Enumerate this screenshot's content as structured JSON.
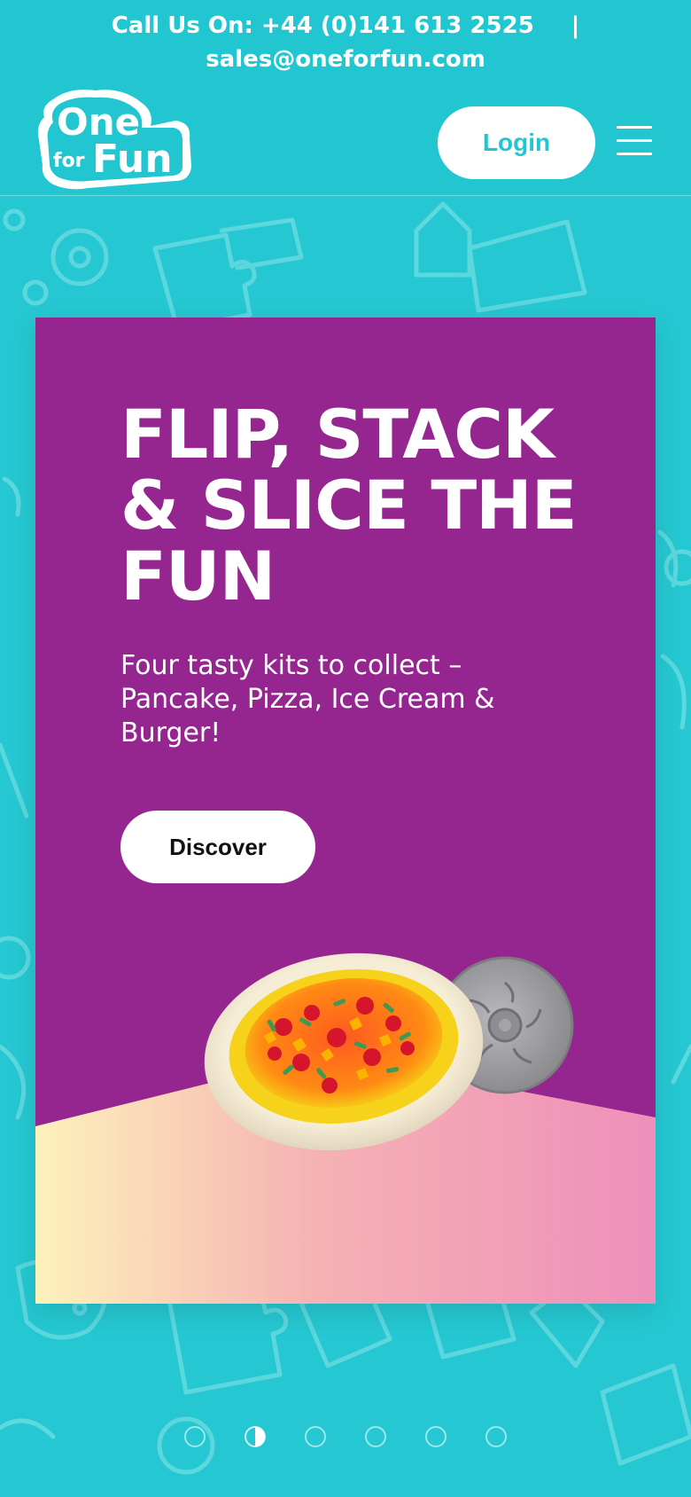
{
  "header": {
    "call_us": "Call Us On: +44 (0)141 613 2525",
    "separator": "|",
    "email": "sales@oneforfun.com",
    "logo": {
      "line1": "One",
      "line2_small": "for",
      "line2_big": "Fun"
    },
    "login_label": "Login",
    "menu_icon": "hamburger-icon"
  },
  "hero": {
    "title": "FLIP, STACK & SLICE THE FUN",
    "subtitle": "Four tasty kits to collect – Pancake, Pizza, Ice Cream & Burger!",
    "cta_label": "Discover",
    "image": "pizza-kit-with-slicer"
  },
  "carousel": {
    "slide_count": 6,
    "active_index": 1
  },
  "colors": {
    "brand_teal": "#25c8d2",
    "hero_purple": "#95268f",
    "floor_yellow": "#fdf2bb",
    "floor_pink": "#ef8fbb",
    "white": "#ffffff"
  }
}
